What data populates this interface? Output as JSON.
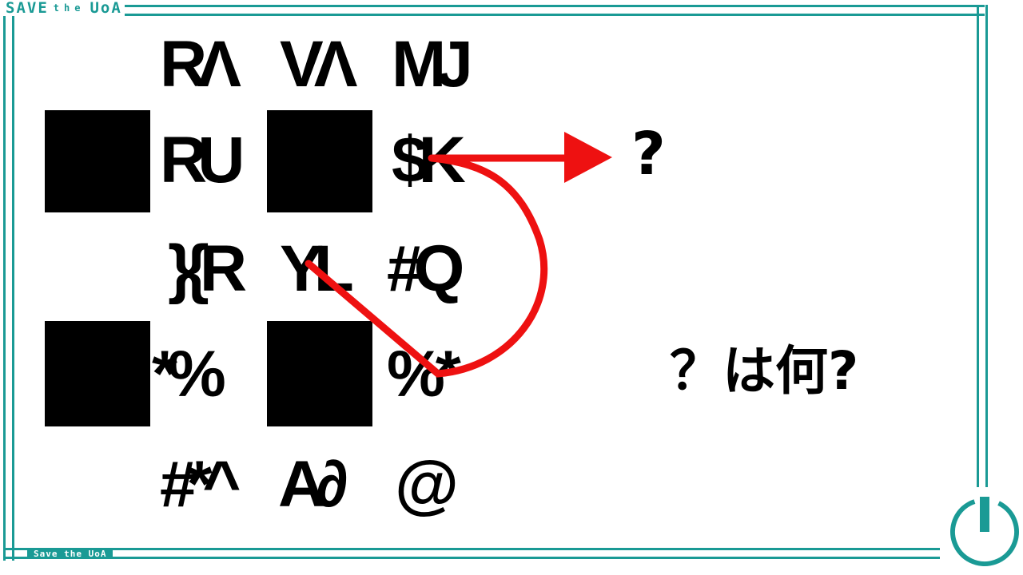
{
  "header": {
    "title_save": "SAVE",
    "title_the": "the",
    "title_uoa": "UoA"
  },
  "footer": {
    "label": "Save the UoA"
  },
  "grid": {
    "r1c2": "RΛ",
    "r1c3": "VΛ",
    "r1c4": "MJ",
    "r2c2": "RU",
    "r2c4": "$K",
    "r3c2": "}{R",
    "r3c3": "YL",
    "r3c4": "#Q",
    "r4c2": "*%",
    "r4c4": "%*",
    "r5c2": "#*^",
    "r5c3": "A∂",
    "r5c4": "@"
  },
  "puzzle": {
    "target_symbol": "?",
    "question": "？は何?"
  },
  "colors": {
    "frame": "#1a9a95",
    "arrow": "#ee1111",
    "block": "#000000"
  },
  "icons": {
    "corner": "power-icon"
  }
}
